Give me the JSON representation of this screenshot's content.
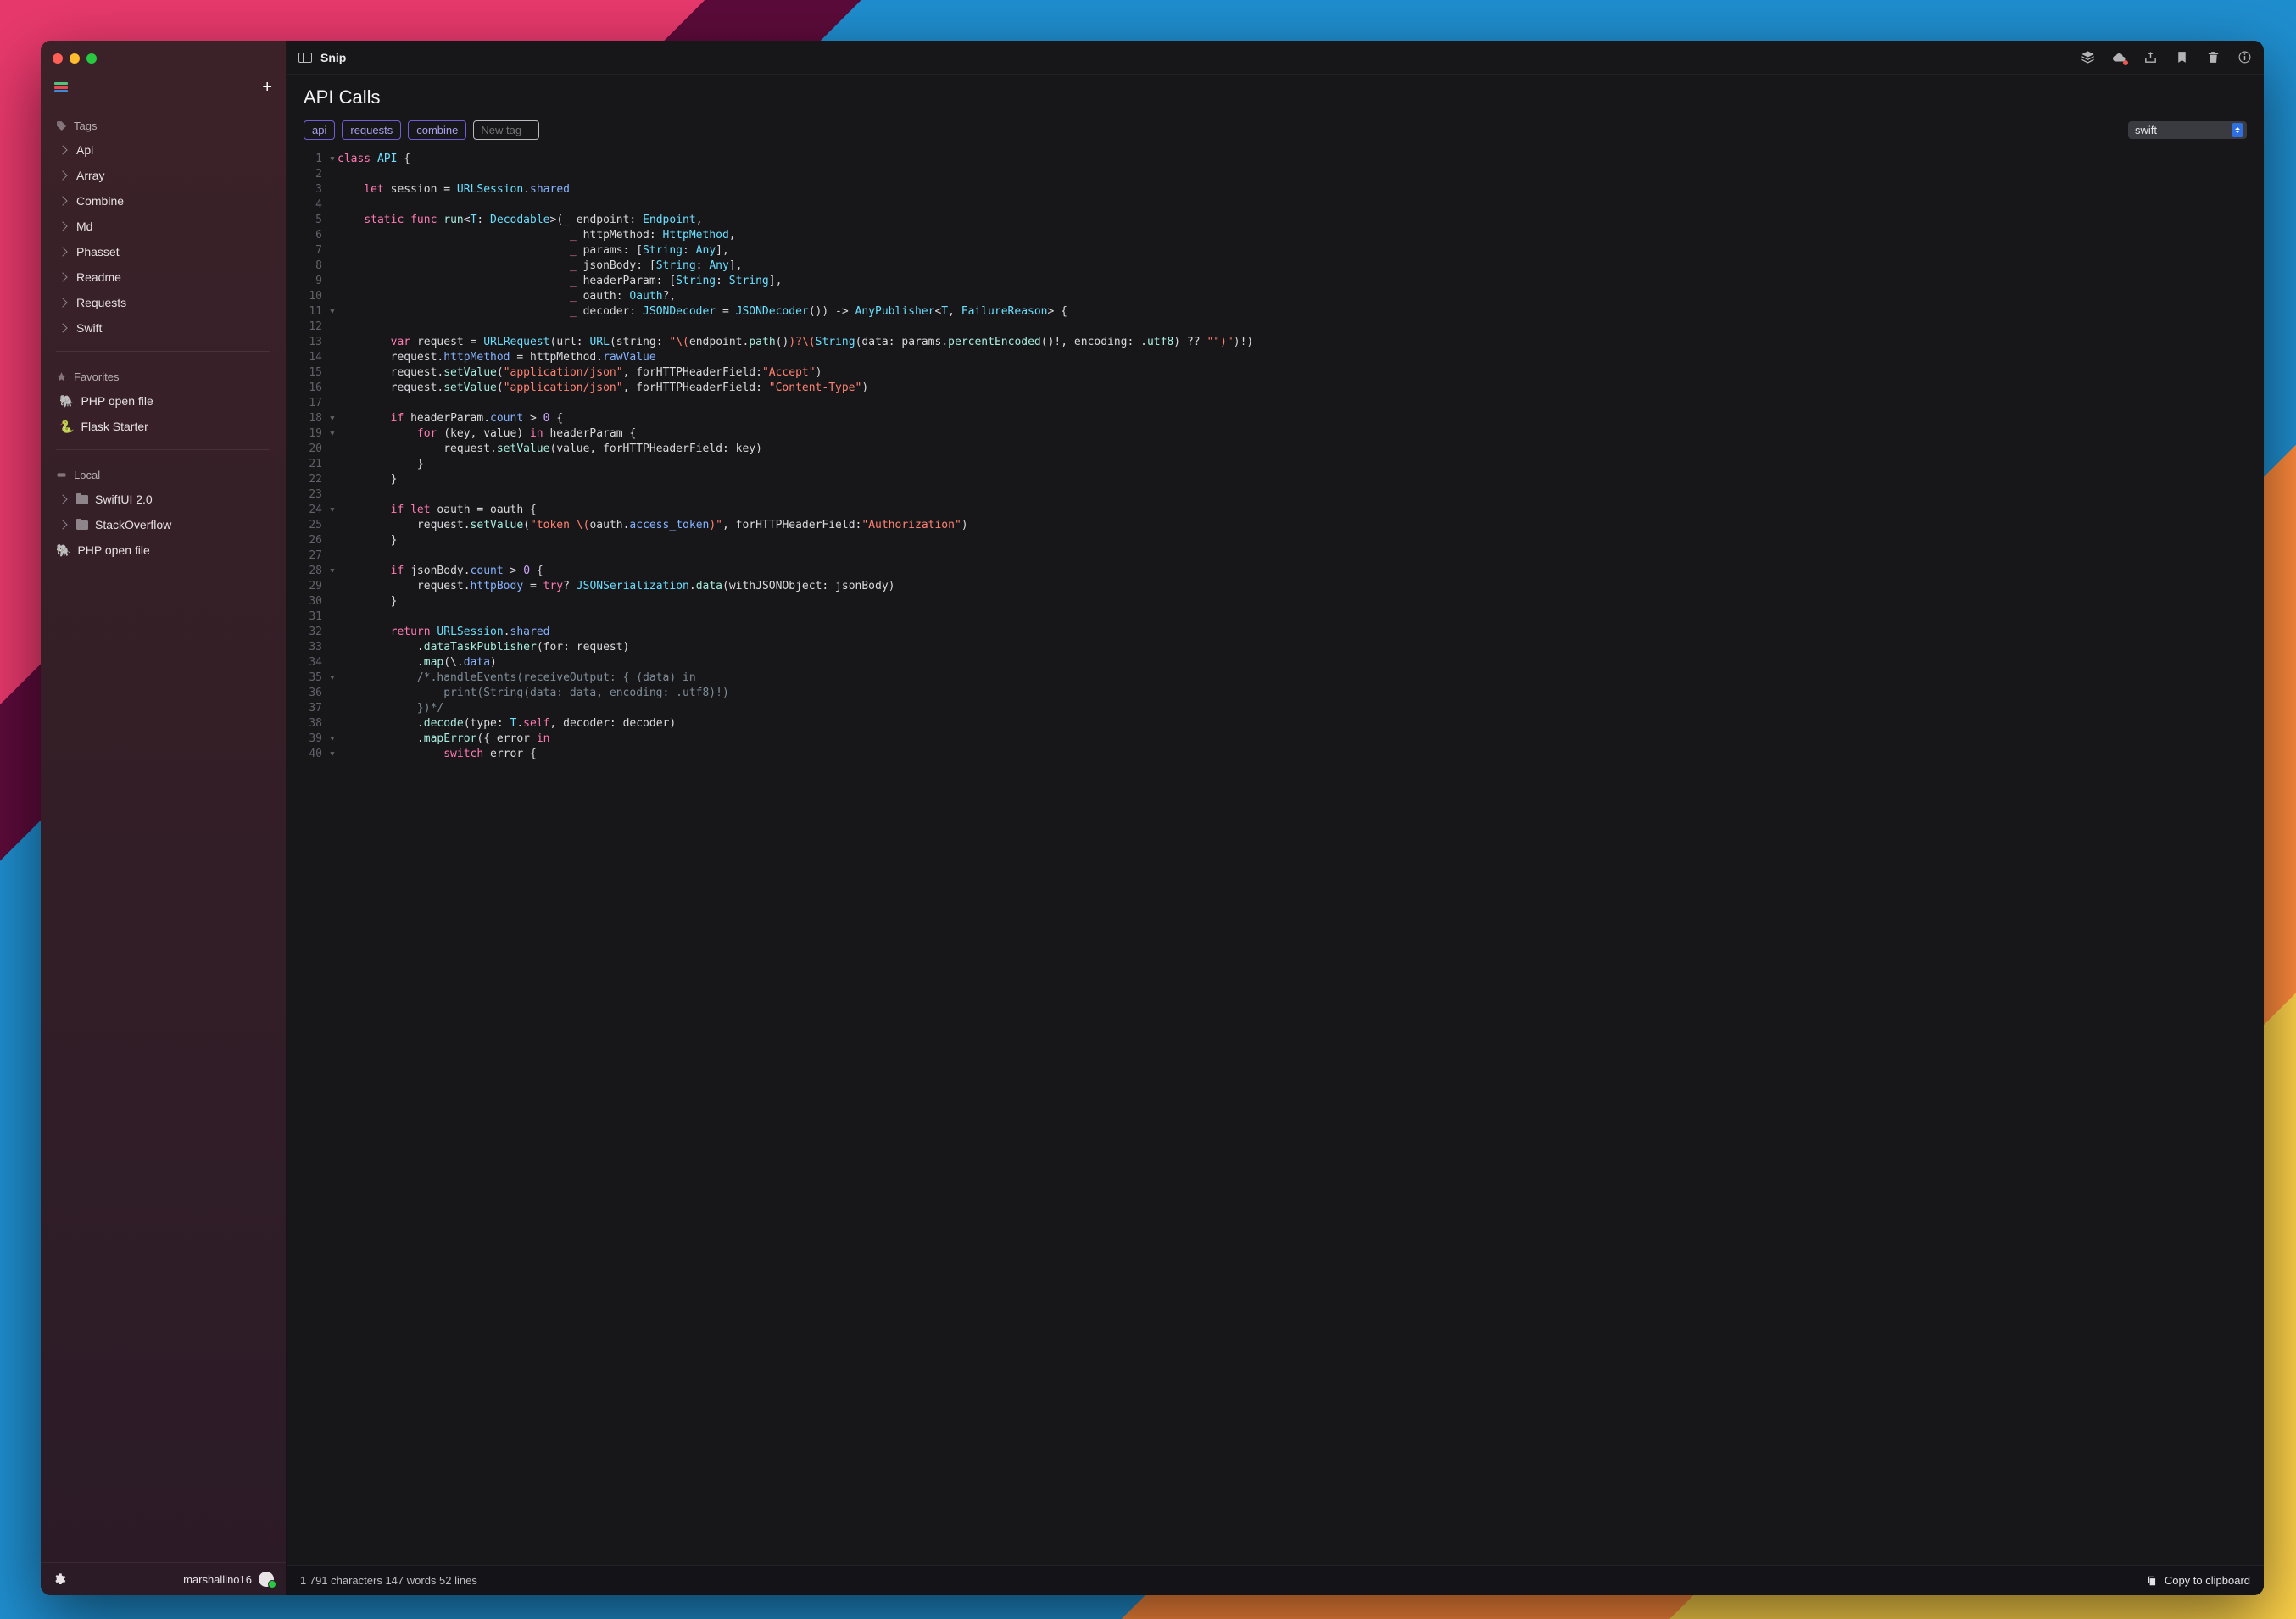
{
  "app": {
    "title": "Snip"
  },
  "sidebar": {
    "tags_heading": "Tags",
    "tags": [
      "Api",
      "Array",
      "Combine",
      "Md",
      "Phasset",
      "Readme",
      "Requests",
      "Swift"
    ],
    "favorites_heading": "Favorites",
    "favorites": [
      {
        "icon": "🐘",
        "label": "PHP open file"
      },
      {
        "icon": "🐍",
        "label": "Flask Starter"
      }
    ],
    "local_heading": "Local",
    "locals": [
      {
        "kind": "folder",
        "label": "SwiftUI 2.0"
      },
      {
        "kind": "folder",
        "label": "StackOverflow"
      },
      {
        "kind": "file",
        "icon": "🐘",
        "label": "PHP open file"
      }
    ],
    "user": "marshallino16"
  },
  "doc": {
    "title": "API Calls",
    "tags": [
      "api",
      "requests",
      "combine"
    ],
    "newtag_placeholder": "New tag",
    "language": "swift"
  },
  "status": {
    "text": "1 791 characters 147 words 52 lines",
    "copy": "Copy to clipboard"
  },
  "code": [
    {
      "n": "1",
      "f": "▾",
      "h": "<span class='kw'>class</span> <span class='ty'>API</span> {"
    },
    {
      "n": "2",
      "h": ""
    },
    {
      "n": "3",
      "h": "    <span class='kw'>let</span> <span class='id'>session</span> = <span class='ty'>URLSession</span>.<span class='pr'>shared</span>"
    },
    {
      "n": "4",
      "h": ""
    },
    {
      "n": "5",
      "h": "    <span class='kw'>static</span> <span class='kw'>func</span> <span class='fn'>run</span>&lt;<span class='ty'>T</span>: <span class='ty'>Decodable</span>&gt;(<span class='kw'>_</span> endpoint: <span class='ty'>Endpoint</span>,"
    },
    {
      "n": "6",
      "h": "                                   <span class='kw'>_</span> httpMethod: <span class='ty'>HttpMethod</span>,"
    },
    {
      "n": "7",
      "h": "                                   <span class='kw'>_</span> params: [<span class='ty'>String</span>: <span class='ty'>Any</span>],"
    },
    {
      "n": "8",
      "h": "                                   <span class='kw'>_</span> jsonBody: [<span class='ty'>String</span>: <span class='ty'>Any</span>],"
    },
    {
      "n": "9",
      "h": "                                   <span class='kw'>_</span> headerParam: [<span class='ty'>String</span>: <span class='ty'>String</span>],"
    },
    {
      "n": "10",
      "h": "                                   <span class='kw'>_</span> oauth: <span class='ty'>Oauth</span>?,"
    },
    {
      "n": "11",
      "f": "▾",
      "h": "                                   <span class='kw'>_</span> decoder: <span class='ty'>JSONDecoder</span> = <span class='ty'>JSONDecoder</span>()) -&gt; <span class='ty'>AnyPublisher</span>&lt;<span class='ty'>T</span>, <span class='ty'>FailureReason</span>&gt; {"
    },
    {
      "n": "12",
      "h": ""
    },
    {
      "n": "13",
      "h": "        <span class='kw'>var</span> <span class='id'>request</span> = <span class='ty'>URLRequest</span>(url: <span class='ty'>URL</span>(string: <span class='st'>\"\\(</span>endpoint.<span class='fn'>path</span>()<span class='st'>)?\\(</span><span class='ty'>String</span>(data: params.<span class='fn'>percentEncoded</span>()!, encoding: .<span class='en'>utf8</span>) ?? <span class='st'>\"\"</span><span class='st'>)\"</span>)!)"
    },
    {
      "n": "14",
      "h": "        request.<span class='pr'>httpMethod</span> = httpMethod.<span class='pr'>rawValue</span>"
    },
    {
      "n": "15",
      "h": "        request.<span class='fn'>setValue</span>(<span class='st'>\"application/json\"</span>, forHTTPHeaderField:<span class='st'>\"Accept\"</span>)"
    },
    {
      "n": "16",
      "h": "        request.<span class='fn'>setValue</span>(<span class='st'>\"application/json\"</span>, forHTTPHeaderField: <span class='st'>\"Content-Type\"</span>)"
    },
    {
      "n": "17",
      "h": ""
    },
    {
      "n": "18",
      "f": "▾",
      "h": "        <span class='kw'>if</span> headerParam.<span class='pr'>count</span> &gt; <span class='nm'>0</span> {"
    },
    {
      "n": "19",
      "f": "▾",
      "h": "            <span class='kw'>for</span> (key, value) <span class='kw'>in</span> headerParam {"
    },
    {
      "n": "20",
      "h": "                request.<span class='fn'>setValue</span>(value, forHTTPHeaderField: key)"
    },
    {
      "n": "21",
      "h": "            }"
    },
    {
      "n": "22",
      "h": "        }"
    },
    {
      "n": "23",
      "h": ""
    },
    {
      "n": "24",
      "f": "▾",
      "h": "        <span class='kw'>if</span> <span class='kw'>let</span> oauth = oauth {"
    },
    {
      "n": "25",
      "h": "            request.<span class='fn'>setValue</span>(<span class='st'>\"token \\(</span>oauth.<span class='pr'>access_token</span><span class='st'>)\"</span>, forHTTPHeaderField:<span class='st'>\"Authorization\"</span>)"
    },
    {
      "n": "26",
      "h": "        }"
    },
    {
      "n": "27",
      "h": ""
    },
    {
      "n": "28",
      "f": "▾",
      "h": "        <span class='kw'>if</span> jsonBody.<span class='pr'>count</span> &gt; <span class='nm'>0</span> {"
    },
    {
      "n": "29",
      "h": "            request.<span class='pr'>httpBody</span> = <span class='kw'>try</span>? <span class='ty'>JSONSerialization</span>.<span class='fn'>data</span>(withJSONObject: jsonBody)"
    },
    {
      "n": "30",
      "h": "        }"
    },
    {
      "n": "31",
      "h": ""
    },
    {
      "n": "32",
      "h": "        <span class='kw'>return</span> <span class='ty'>URLSession</span>.<span class='pr'>shared</span>"
    },
    {
      "n": "33",
      "h": "            .<span class='fn'>dataTaskPublisher</span>(for: request)"
    },
    {
      "n": "34",
      "h": "            .<span class='fn'>map</span>(\\.<span class='pr'>data</span>)"
    },
    {
      "n": "35",
      "f": "▾",
      "h": "            <span class='cm'>/*.handleEvents(receiveOutput: { (data) in</span>"
    },
    {
      "n": "36",
      "h": "            <span class='cm'>    print(String(data: data, encoding: .utf8)!)</span>"
    },
    {
      "n": "37",
      "h": "            <span class='cm'>})*/</span>"
    },
    {
      "n": "38",
      "h": "            .<span class='fn'>decode</span>(type: <span class='ty'>T</span>.<span class='kw'>self</span>, decoder: decoder)"
    },
    {
      "n": "39",
      "f": "▾",
      "h": "            .<span class='fn'>mapError</span>({ error <span class='kw'>in</span>"
    },
    {
      "n": "40",
      "f": "▾",
      "h": "                <span class='kw'>switch</span> error {"
    }
  ]
}
